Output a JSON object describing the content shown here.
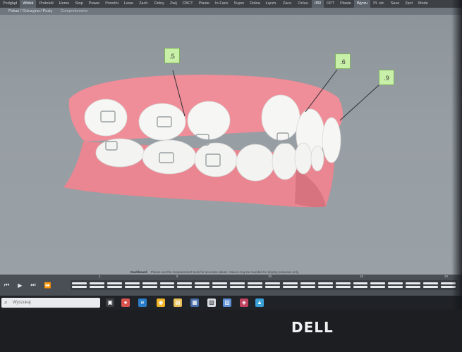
{
  "menubar": {
    "items": [
      "Podgląd",
      "Widok",
      "Protokół",
      "Home",
      "Stop",
      "Prawe",
      "Przedni",
      "Lewe",
      "Zach.",
      "Dolny",
      "Zwij",
      "CBCT",
      "Plaste",
      "In-Face",
      "Super",
      "Dolna",
      "Łączn.",
      "Zacz.",
      "Ocluz.",
      "IPR",
      "DPT",
      "Ptaste",
      "Wyrzu",
      "Pl. stc.",
      "Save",
      "Zpct",
      "Mode"
    ],
    "active": [
      "Widok",
      "IPR",
      "Wyrzu"
    ]
  },
  "titlebar": {
    "title": "Pokaż / Ocluzyjna / Pusty",
    "subtitle": "Comprehensive"
  },
  "callouts": [
    {
      "label": ".5"
    },
    {
      "label": ".6"
    },
    {
      "label": ".9"
    }
  ],
  "colors": {
    "gum": "#ef8d98",
    "teeth": "#f6f6f4",
    "callout_bg": "#c8f0a8"
  },
  "statusbar": {
    "label": "Dashboard",
    "text": "Please use the measurement tools for accurate values. Values may be rounded for display purposes only."
  },
  "timeline": {
    "frame_labels": [
      "1",
      "5",
      "10",
      "15",
      "20"
    ],
    "controls": [
      "skip-back-icon",
      "play-icon",
      "step-forward-icon",
      "skip-forward-icon"
    ]
  },
  "taskbar": {
    "search_placeholder": "Wyszukaj",
    "icons": [
      "task-view-icon",
      "browser-icon",
      "edge-icon",
      "chrome-icon",
      "files-icon",
      "store-icon",
      "app-icon",
      "photos-icon",
      "viewer-icon",
      "app2-icon"
    ]
  },
  "bezel": {
    "brand": "DELL"
  }
}
